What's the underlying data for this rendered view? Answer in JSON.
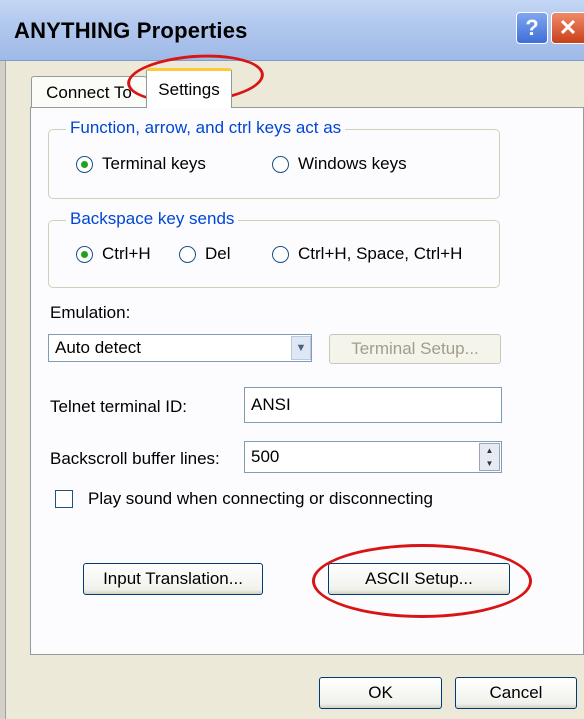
{
  "window": {
    "title": "ANYTHING Properties",
    "help_glyph": "?",
    "close_glyph": "✕"
  },
  "tabs": [
    {
      "label": "Connect To"
    },
    {
      "label": "Settings"
    }
  ],
  "function_keys": {
    "legend": "Function, arrow, and ctrl keys act as",
    "options": [
      {
        "label": "Terminal keys",
        "selected": true
      },
      {
        "label": "Windows keys",
        "selected": false
      }
    ]
  },
  "backspace": {
    "legend": "Backspace key sends",
    "options": [
      {
        "label": "Ctrl+H",
        "selected": true
      },
      {
        "label": "Del",
        "selected": false
      },
      {
        "label": "Ctrl+H, Space, Ctrl+H",
        "selected": false
      }
    ]
  },
  "emulation": {
    "label": "Emulation:",
    "value": "Auto detect",
    "terminal_setup_label": "Terminal Setup..."
  },
  "telnet": {
    "label": "Telnet terminal ID:",
    "value": "ANSI"
  },
  "backscroll": {
    "label": "Backscroll buffer lines:",
    "value": "500"
  },
  "sound": {
    "label": "Play sound when connecting or disconnecting",
    "checked": false
  },
  "buttons": {
    "input_translation": "Input Translation...",
    "ascii_setup": "ASCII Setup...",
    "ok": "OK",
    "cancel": "Cancel"
  },
  "colors": {
    "accent": "#0046d5",
    "annotation": "#d81414",
    "radio_dot": "#21a121"
  }
}
